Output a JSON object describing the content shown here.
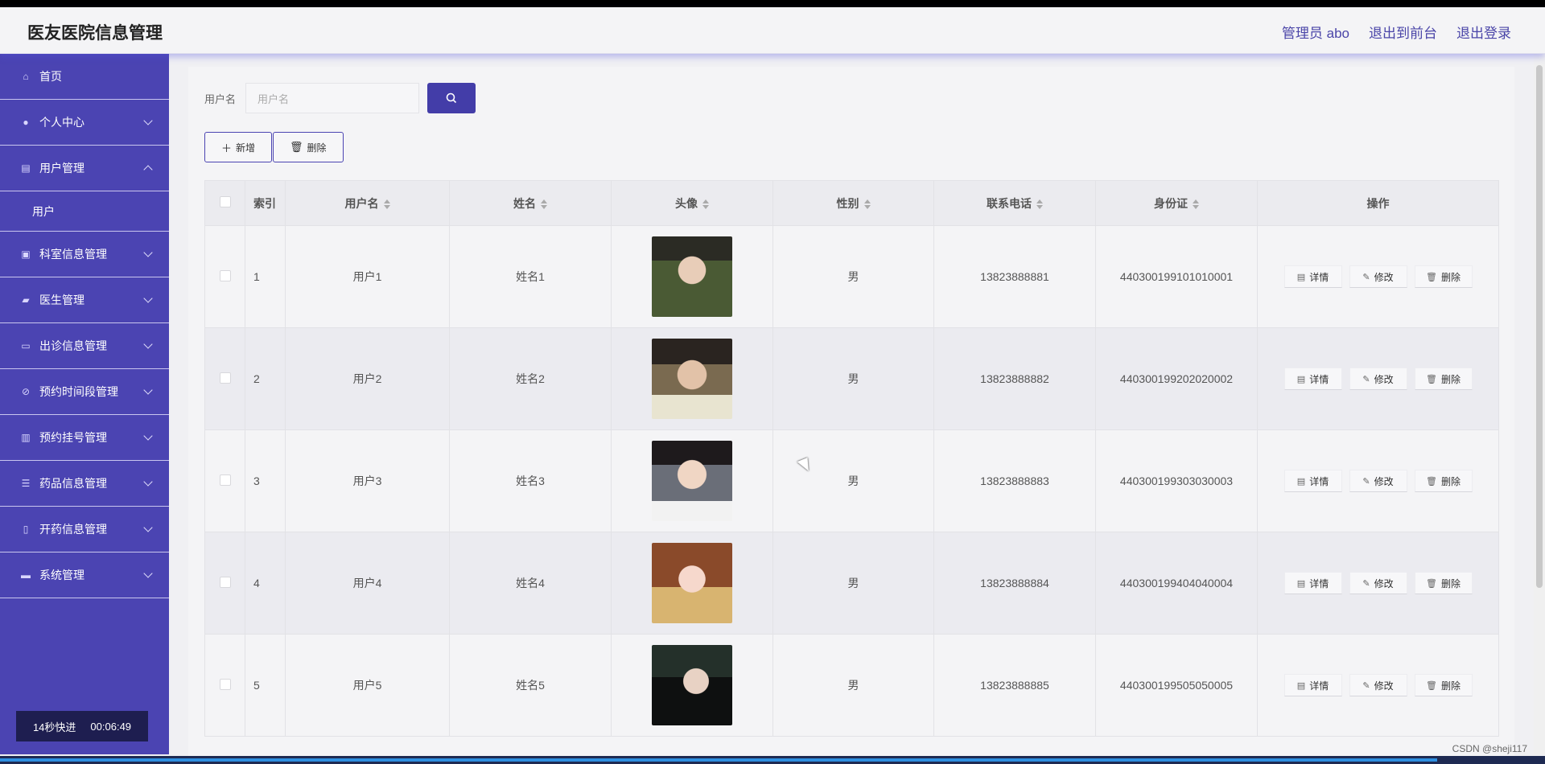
{
  "header": {
    "title": "医友医院信息管理",
    "nav": [
      "管理员 abo",
      "退出到前台",
      "退出登录"
    ]
  },
  "sidebar": {
    "items": [
      {
        "label": "首页",
        "icon": "home-icon",
        "expandable": false
      },
      {
        "label": "个人中心",
        "icon": "user-icon",
        "expandable": true
      },
      {
        "label": "用户管理",
        "icon": "clipboard-icon",
        "expandable": true,
        "expanded": true,
        "children": [
          "用户"
        ]
      },
      {
        "label": "科室信息管理",
        "icon": "briefcase-icon",
        "expandable": true
      },
      {
        "label": "医生管理",
        "icon": "thumb-icon",
        "expandable": true
      },
      {
        "label": "出诊信息管理",
        "icon": "card-icon",
        "expandable": true
      },
      {
        "label": "预约时间段管理",
        "icon": "bell-off-icon",
        "expandable": true
      },
      {
        "label": "预约挂号管理",
        "icon": "clipboard-check-icon",
        "expandable": true
      },
      {
        "label": "药品信息管理",
        "icon": "list-icon",
        "expandable": true
      },
      {
        "label": "开药信息管理",
        "icon": "phone-icon",
        "expandable": true
      },
      {
        "label": "系统管理",
        "icon": "ticket-icon",
        "expandable": true
      }
    ]
  },
  "video_badge": {
    "label": "14秒快进",
    "time": "00:06:49"
  },
  "search": {
    "label": "用户名",
    "placeholder": "用户名"
  },
  "toolbar": {
    "add_label": "新增",
    "delete_label": "删除"
  },
  "table": {
    "columns": [
      "索引",
      "用户名",
      "姓名",
      "头像",
      "性别",
      "联系电话",
      "身份证",
      "操作"
    ],
    "row_actions": [
      "详情",
      "修改",
      "删除"
    ],
    "rows": [
      {
        "index": "1",
        "username": "用户1",
        "name": "姓名1",
        "gender": "男",
        "phone": "13823888881",
        "id_card": "440300199101010001"
      },
      {
        "index": "2",
        "username": "用户2",
        "name": "姓名2",
        "gender": "男",
        "phone": "13823888882",
        "id_card": "440300199202020002"
      },
      {
        "index": "3",
        "username": "用户3",
        "name": "姓名3",
        "gender": "男",
        "phone": "13823888883",
        "id_card": "440300199303030003"
      },
      {
        "index": "4",
        "username": "用户4",
        "name": "姓名4",
        "gender": "男",
        "phone": "13823888884",
        "id_card": "440300199404040004"
      },
      {
        "index": "5",
        "username": "用户5",
        "name": "姓名5",
        "gender": "男",
        "phone": "13823888885",
        "id_card": "440300199505050005"
      }
    ]
  },
  "progress": 0.93,
  "watermark": "CSDN @sheji117",
  "colors": {
    "accent": "#4b44b2",
    "button": "#433da8",
    "header_nav": "#4a45a8"
  }
}
